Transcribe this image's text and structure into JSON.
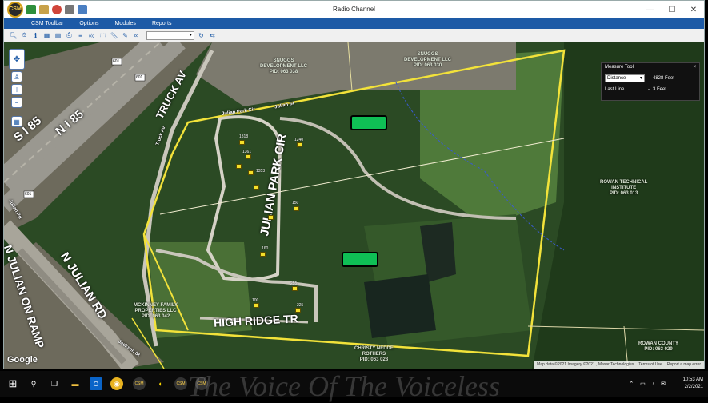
{
  "window": {
    "title": "Radio Channel",
    "app_logo": "CSM",
    "controls": [
      "—",
      "☐",
      "✕"
    ]
  },
  "menu": [
    "CSM Toolbar",
    "Options",
    "Modules",
    "Reports"
  ],
  "toolbar": {
    "icons": [
      "zoom-icon",
      "pan-hand-icon",
      "info-icon",
      "map-icon",
      "table-icon",
      "print-icon",
      "layers-icon",
      "identify-icon",
      "select-icon",
      "measure-icon",
      "draw-icon",
      "binoculars-icon",
      "refresh-icon",
      "back-icon"
    ]
  },
  "map": {
    "google_logo": "Google",
    "attribution": [
      "Map data ©2021 Imagery ©2021 , Maxar Technologies",
      "Terms of Use",
      "Report a map error"
    ],
    "labels": {
      "snuggs1": "SNUGGS\nDEVELOPMENT LLC\nPID: 063 038",
      "snuggs2": "SNUGGS\nDEVELOPMENT LLC\nPID: 063 030",
      "rowan_tech": "ROWAN TECHNICAL\nINSTITUTE\nPID: 063 013",
      "mckinney": "MCKINNEY FAMILY\nPROPERTIES LLC\nPID: 063 042",
      "christy": "CHRISTY NEDDE\nROTHERS\nPID: 063 028",
      "rowan_county": "ROWAN COUNTY\nPID: 063 029"
    },
    "roads": {
      "s_i85": "S I 85",
      "n_i85": "N I 85",
      "truck_av": "TRUCK AV",
      "julian_park": "JULIAN PARK CIR",
      "high_ridge": "HIGH RIDGE TR",
      "n_julian": "N JULIAN RD",
      "julian_ramp": "N JULIAN ON RAMP",
      "julian_st": "Julian St",
      "julian_park_small": "Julian Park Cir",
      "julian_rd_small": "Julian Rd",
      "truck_av_small": "Truck Av",
      "jackson_st": "Jackson St"
    },
    "houses": [
      "1240",
      "1361",
      "1353",
      "1318",
      "150",
      "160",
      "255",
      "225",
      "100"
    ],
    "shields": [
      "601",
      "601",
      "601"
    ]
  },
  "measure_tool": {
    "title": "Measure Tool",
    "close": "×",
    "rows": [
      {
        "selector": "Distance",
        "value": "4828 Feet"
      },
      {
        "selector": "Last Line",
        "value": "3 Feet"
      }
    ]
  },
  "taskbar": {
    "watermark": "The Voice Of The Voiceless",
    "time": "10:53 AM",
    "date": "2/2/2021",
    "icons": [
      "windows-icon",
      "search-icon",
      "task-view-icon",
      "file-explorer-icon",
      "outlook-icon",
      "chrome-icon",
      "csm-icon",
      "duck-icon",
      "csm2-icon",
      "csm3-icon"
    ]
  },
  "colors": {
    "menu_blue": "#1d5aa6",
    "parcel_yellow": "#f2e23a",
    "marker_green": "#0fbf55"
  }
}
